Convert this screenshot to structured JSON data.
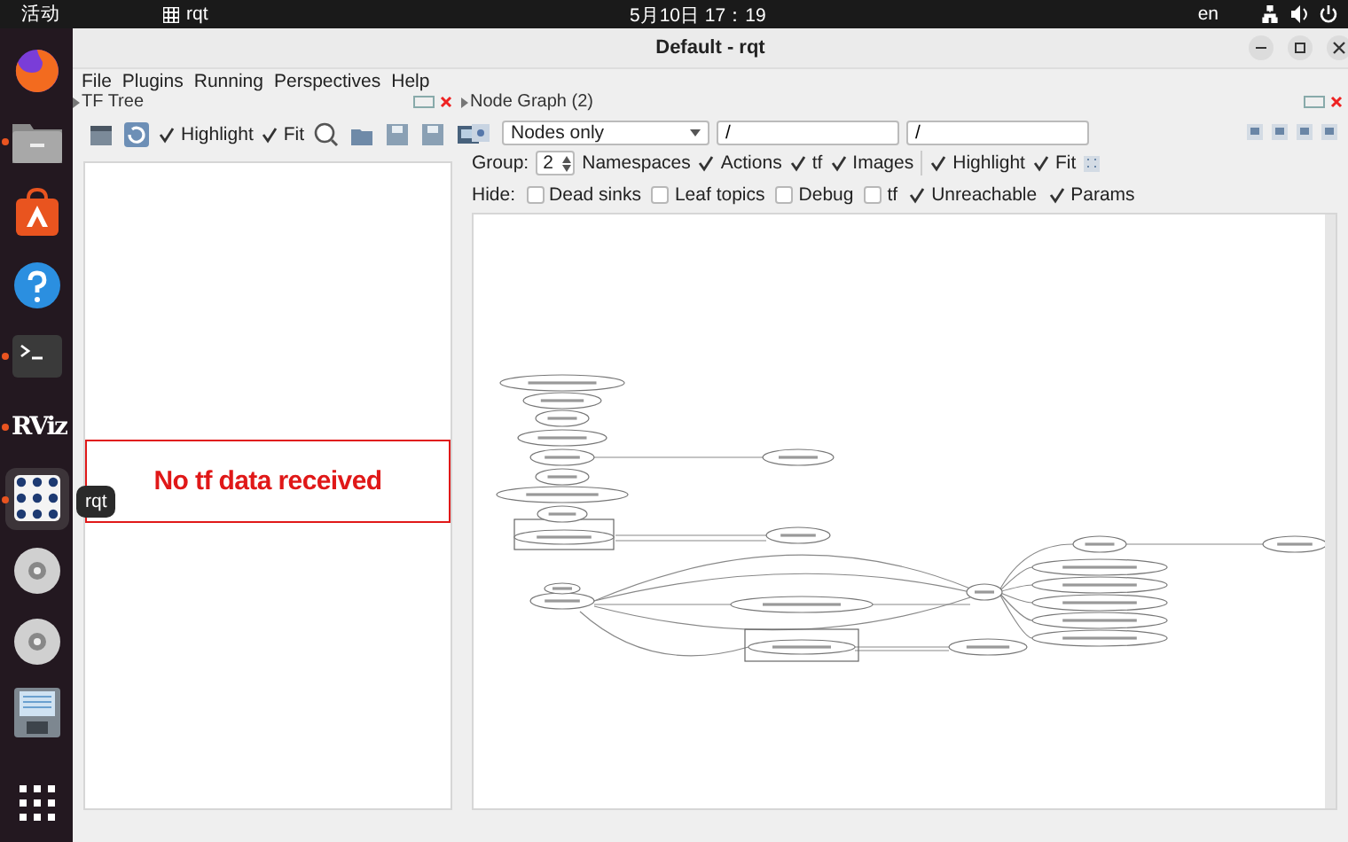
{
  "top_bar": {
    "activities": "活动",
    "app": "rqt",
    "clock": "5月10日 17：19",
    "language": "en"
  },
  "dock": {
    "tooltip": "rqt",
    "items": [
      {
        "kind": "firefox",
        "running": false,
        "selected": false
      },
      {
        "kind": "files",
        "running": true,
        "selected": false
      },
      {
        "kind": "store",
        "running": false,
        "selected": false
      },
      {
        "kind": "help",
        "running": false,
        "selected": false
      },
      {
        "kind": "terminal",
        "running": true,
        "selected": false
      },
      {
        "kind": "rviz",
        "label": "RViz",
        "running": true,
        "selected": false
      },
      {
        "kind": "rqt",
        "running": true,
        "selected": true
      },
      {
        "kind": "disc",
        "running": false,
        "selected": false
      },
      {
        "kind": "disc",
        "running": false,
        "selected": false
      },
      {
        "kind": "floppy",
        "running": false,
        "selected": false
      },
      {
        "kind": "apps",
        "running": false,
        "selected": false
      }
    ]
  },
  "window": {
    "title": "Default - rqt"
  },
  "menu": [
    "File",
    "Plugins",
    "Running",
    "Perspectives",
    "Help"
  ],
  "tf_tree": {
    "title": "TF Tree",
    "checks": [
      {
        "label": "Highlight",
        "checked": true
      },
      {
        "label": "Fit",
        "checked": true
      }
    ],
    "message": "No tf data received"
  },
  "node_graph": {
    "title": "Node Graph (2)",
    "mode": "Nodes only",
    "filters": [
      "/",
      "/"
    ],
    "group_prefix": "Group:",
    "group": "2",
    "group_label": "Namespaces",
    "checks": [
      {
        "label": "Actions",
        "checked": true
      },
      {
        "label": "tf",
        "checked": true
      },
      {
        "label": "Images",
        "checked": true
      },
      {
        "label": "Highlight",
        "checked": true
      },
      {
        "label": "Fit",
        "checked": true
      }
    ],
    "hide_label": "Hide:",
    "hide": [
      {
        "label": "Dead sinks",
        "checked": false
      },
      {
        "label": "Leaf topics",
        "checked": false
      },
      {
        "label": "Debug",
        "checked": false
      },
      {
        "label": "tf",
        "checked": false
      },
      {
        "label": "Unreachable",
        "checked": true
      },
      {
        "label": "Params",
        "checked": true
      }
    ]
  }
}
